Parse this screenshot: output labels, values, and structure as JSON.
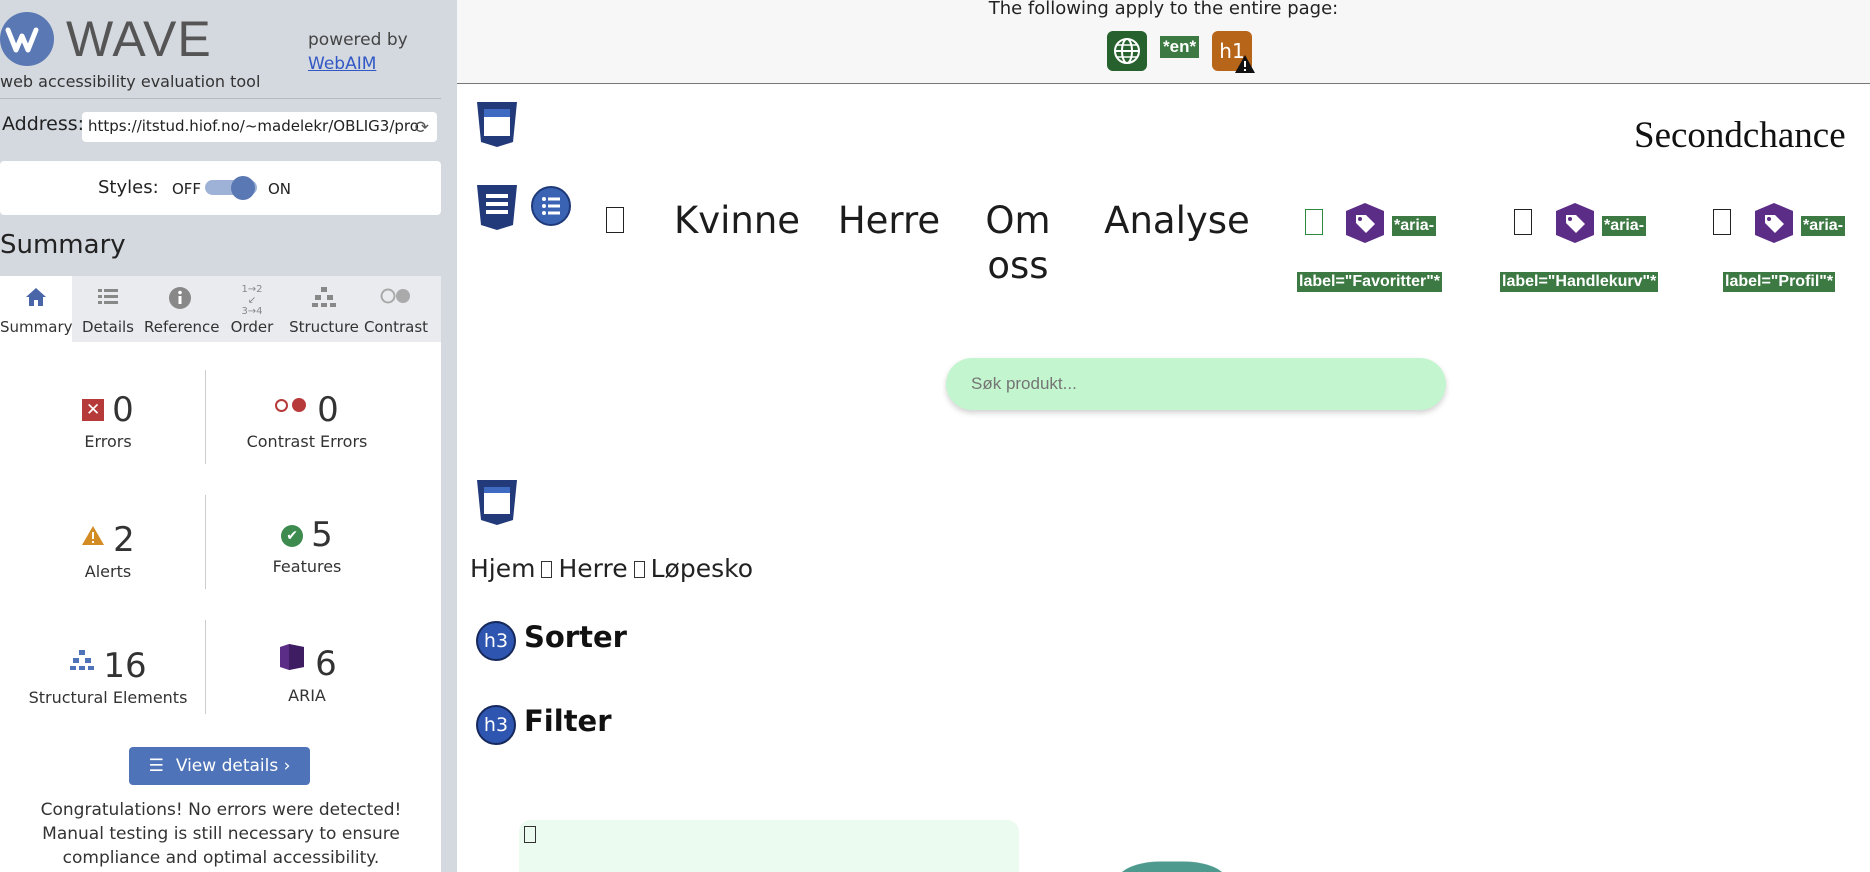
{
  "sidebar": {
    "logo_text": "WAVE",
    "tagline": "web accessibility evaluation tool",
    "powered_by": "powered by",
    "webaim_link": "WebAIM",
    "address_label": "Address:",
    "address_value": "https://itstud.hiof.no/~madelekr/OBLIG3/pro",
    "styles_label": "Styles:",
    "styles_off": "OFF",
    "styles_on": "ON",
    "section_title": "Summary",
    "tabs": [
      {
        "label": "Summary",
        "icon": "home-icon"
      },
      {
        "label": "Details",
        "icon": "list-icon"
      },
      {
        "label": "Reference",
        "icon": "info-icon"
      },
      {
        "label": "Order",
        "icon": "order-icon"
      },
      {
        "label": "Structure",
        "icon": "structure-icon"
      },
      {
        "label": "Contrast",
        "icon": "contrast-icon"
      }
    ],
    "stats": {
      "errors": {
        "value": "0",
        "label": "Errors"
      },
      "contrast_errors": {
        "value": "0",
        "label": "Contrast Errors"
      },
      "alerts": {
        "value": "2",
        "label": "Alerts"
      },
      "features": {
        "value": "5",
        "label": "Features"
      },
      "structural": {
        "value": "16",
        "label": "Structural Elements"
      },
      "aria": {
        "value": "6",
        "label": "ARIA"
      }
    },
    "view_details": "View details ›",
    "congrats": "Congratulations! No errors were detected! Manual testing is still necessary to ensure compliance and optimal accessibility."
  },
  "page": {
    "banner_text": "The following apply to the entire page:",
    "lang_badge": "*en*",
    "h1_badge": "h1",
    "brand": "Secondchance",
    "nav": [
      "Kvinne",
      "Herre",
      "Om oss",
      "Analyse"
    ],
    "aria_labels": [
      {
        "top": "*aria-",
        "bottom": "label=\"Favoritter\"*"
      },
      {
        "top": "*aria-",
        "bottom": "label=\"Handlekurv\"*"
      },
      {
        "top": "*aria-",
        "bottom": "label=\"Profil\"*"
      }
    ],
    "search_placeholder": "Søk produkt...",
    "breadcrumbs": [
      "Hjem",
      "Herre",
      "Løpesko"
    ],
    "h3_badge": "h3",
    "headings": [
      "Sorter",
      "Filter"
    ]
  },
  "colors": {
    "wave_blue": "#5a78b3",
    "error_red": "#b73a3a",
    "feature_green": "#3d8b4e",
    "alert_orange": "#d38b24",
    "aria_purple": "#5b2d86",
    "badge_green": "#3d7a43",
    "search_green": "#c3f5cf"
  }
}
